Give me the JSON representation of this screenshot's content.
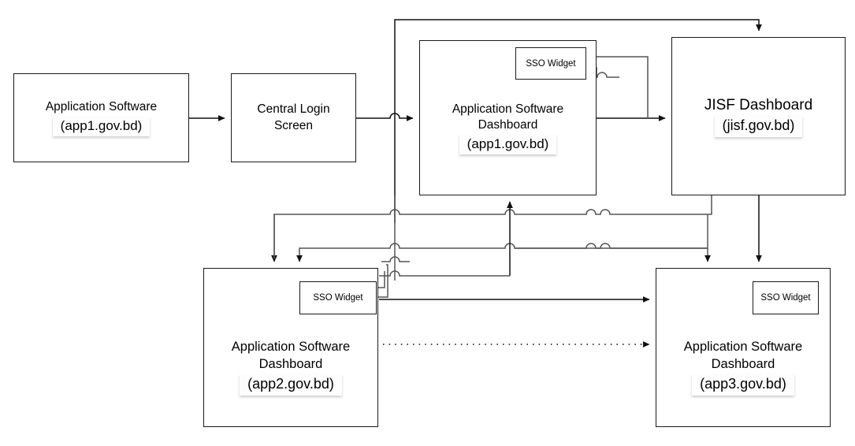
{
  "diagram": {
    "title": "SSO integration flow between government application dashboards",
    "stroke_color": "#1a1a1a",
    "background_color": "#ffffff",
    "nodes": [
      {
        "id": "app1",
        "name": "application-software-app1",
        "label": "Application Software",
        "identifier": "(app1.gov.bd)",
        "widget": null
      },
      {
        "id": "login",
        "name": "central-login-screen",
        "label": "Central Login",
        "label2": "Screen",
        "identifier": "",
        "widget": null
      },
      {
        "id": "dash1",
        "name": "application-software-dashboard-app1",
        "label": "Application Software",
        "label2": "Dashboard",
        "identifier": "(app1.gov.bd)",
        "widget": "SSO Widget"
      },
      {
        "id": "jisf",
        "name": "jisf-dashboard",
        "label": "JISF Dashboard",
        "identifier": "(jisf.gov.bd)",
        "widget": null
      },
      {
        "id": "dash2",
        "name": "application-software-dashboard-app2",
        "label": "Application Software",
        "label2": "Dashboard",
        "identifier": "(app2.gov.bd)",
        "widget": "SSO Widget"
      },
      {
        "id": "dash3",
        "name": "application-software-dashboard-app3",
        "label": "Application Software",
        "label2": "Dashboard",
        "identifier": "(app3.gov.bd)",
        "widget": "SSO Widget"
      }
    ],
    "edges": [
      {
        "from": "app1",
        "to": "login",
        "style": "solid"
      },
      {
        "from": "login",
        "to": "dash1",
        "style": "solid"
      },
      {
        "from": "dash1",
        "to": "jisf",
        "style": "solid"
      },
      {
        "from": "dash1",
        "to": "jisf",
        "style": "solid"
      },
      {
        "from": "dash1",
        "to": "dash2",
        "style": "solid"
      },
      {
        "from": "dash1",
        "to": "dash3",
        "style": "solid"
      },
      {
        "from": "jisf",
        "to": "dash1",
        "style": "solid"
      },
      {
        "from": "jisf",
        "to": "dash3",
        "style": "solid"
      },
      {
        "from": "jisf",
        "to": "dash2",
        "style": "solid"
      },
      {
        "from": "dash2",
        "to": "dash1",
        "style": "solid"
      },
      {
        "from": "dash2",
        "to": "dash3",
        "style": "solid"
      },
      {
        "from": "dash2",
        "to": "dash3",
        "style": "dotted"
      },
      {
        "from": "dash2",
        "to": "jisf",
        "style": "solid"
      }
    ]
  }
}
